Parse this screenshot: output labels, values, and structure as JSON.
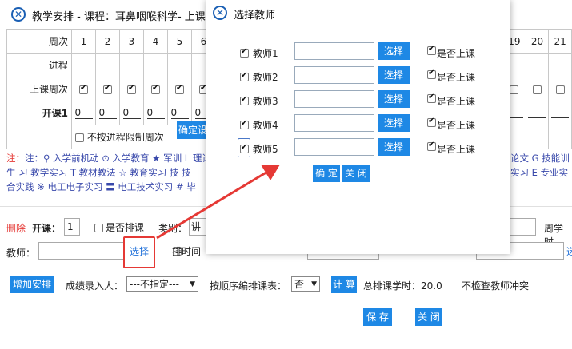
{
  "main": {
    "title": "教学安排 - 课程：耳鼻咽喉科学- 上课",
    "table": {
      "header_label": "周次",
      "weeks_left": [
        "1",
        "2",
        "3",
        "4",
        "5",
        "6"
      ],
      "weeks_right": [
        "19",
        "20",
        "21"
      ],
      "row_progress": "进程",
      "row_weeks": "上课周次",
      "row_kaike": "开课1",
      "kaike_value": "0",
      "no_progress_limit": "不按进程限制周次",
      "confirm_btn": "确定设"
    },
    "legend": {
      "line1_left": "注：♀ 入学前机动  ⊙ 入学教育  ★ 军训  L 理论",
      "line1_right": "论文  G 技能训",
      "line2_left": "生  习 教学实习  T 教材教法  ☆ 教育实习  技 技",
      "line2_right": "实习  E 专业实",
      "line3_left": "合实践  ※ 电工电子实习  〓 电工技术实习  # 毕"
    },
    "form": {
      "delete_label": "删除",
      "kaike_label": "开课：",
      "kaike_value": "1",
      "is_paike": "是否排课",
      "category_label": "类别：",
      "category_value": "讲",
      "semester_hours": "周学时",
      "teacher_label": "教师：",
      "select_link": "选择",
      "pai_time": "排时间",
      "right_link": "选"
    },
    "bottom": {
      "add_btn": "增加安排",
      "score_entry_label": "成绩录入人：",
      "score_entry_value": "---不指定---",
      "order_label": "按顺序编排课表：",
      "order_value": "否",
      "calc_btn": "计 算",
      "total_hours": "总排课学时：20.0",
      "no_check": "不检查教师冲突",
      "save_btn": "保 存",
      "close_btn": "关 闭"
    }
  },
  "dialog": {
    "title": "选择教师",
    "rows": [
      {
        "label": "教师1",
        "select": "选择",
        "attend": "是否上课",
        "checked": true
      },
      {
        "label": "教师2",
        "select": "选择",
        "attend": "是否上课",
        "checked": true
      },
      {
        "label": "教师3",
        "select": "选择",
        "attend": "是否上课",
        "checked": true
      },
      {
        "label": "教师4",
        "select": "选择",
        "attend": "是否上课",
        "checked": true
      },
      {
        "label": "教师5",
        "select": "选择",
        "attend": "是否上课",
        "checked": true
      }
    ],
    "confirm_btn": "确 定",
    "close_btn": "关 闭"
  },
  "colors": {
    "accent": "#1e88e5",
    "annotation": "#e53935",
    "legend": "#3949ab"
  }
}
